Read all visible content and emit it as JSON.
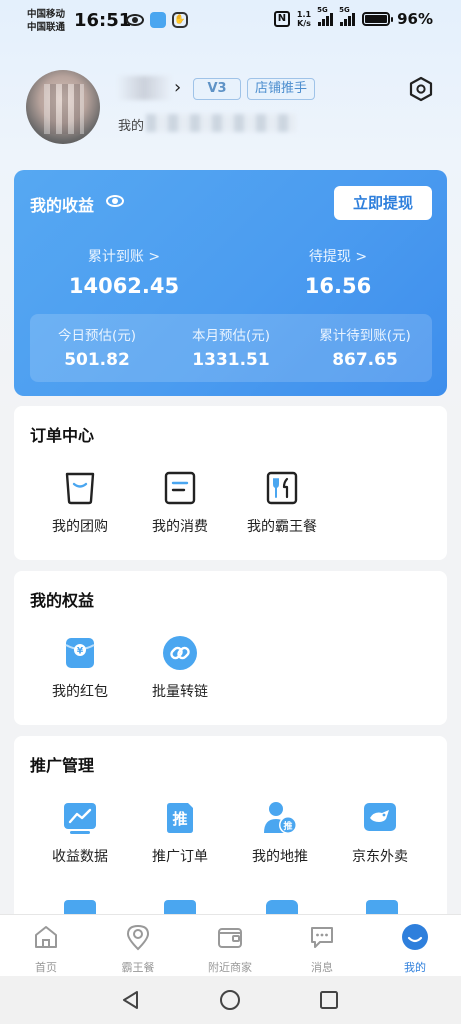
{
  "status_bar": {
    "carrier_1": "中国移动",
    "carrier_2": "中国联通",
    "time": "16:51",
    "speed_top": "1.1",
    "speed_bottom": "K/s",
    "network_1": "5G",
    "network_2": "5G",
    "battery": "96%"
  },
  "profile": {
    "name_visible": "",
    "level_badge": "V3",
    "role_badge": "店铺推手",
    "invite_prefix": "我的"
  },
  "earnings": {
    "title": "我的收益",
    "withdraw_button": "立即提现",
    "total_received_label": "累计到账 >",
    "total_received_value": "14062.45",
    "pending_withdraw_label": "待提现 >",
    "pending_withdraw_value": "16.56",
    "today_label": "今日预估(元)",
    "today_value": "501.82",
    "month_label": "本月预估(元)",
    "month_value": "1331.51",
    "pending_account_label": "累计待到账(元)",
    "pending_account_value": "867.65"
  },
  "orders": {
    "title": "订单中心",
    "items": [
      "我的团购",
      "我的消费",
      "我的霸王餐"
    ]
  },
  "benefits": {
    "title": "我的权益",
    "items": [
      "我的红包",
      "批量转链"
    ]
  },
  "promotion": {
    "title": "推广管理",
    "items": [
      "收益数据",
      "推广订单",
      "我的地推",
      "京东外卖"
    ],
    "badge_text": "推"
  },
  "tabs": {
    "items": [
      "首页",
      "霸王餐",
      "附近商家",
      "消息",
      "我的"
    ],
    "active": "我的"
  },
  "colors": {
    "accent": "#2e7fdc",
    "card_blue": "#4b9cf0",
    "icon_blue": "#4aa6f0"
  }
}
